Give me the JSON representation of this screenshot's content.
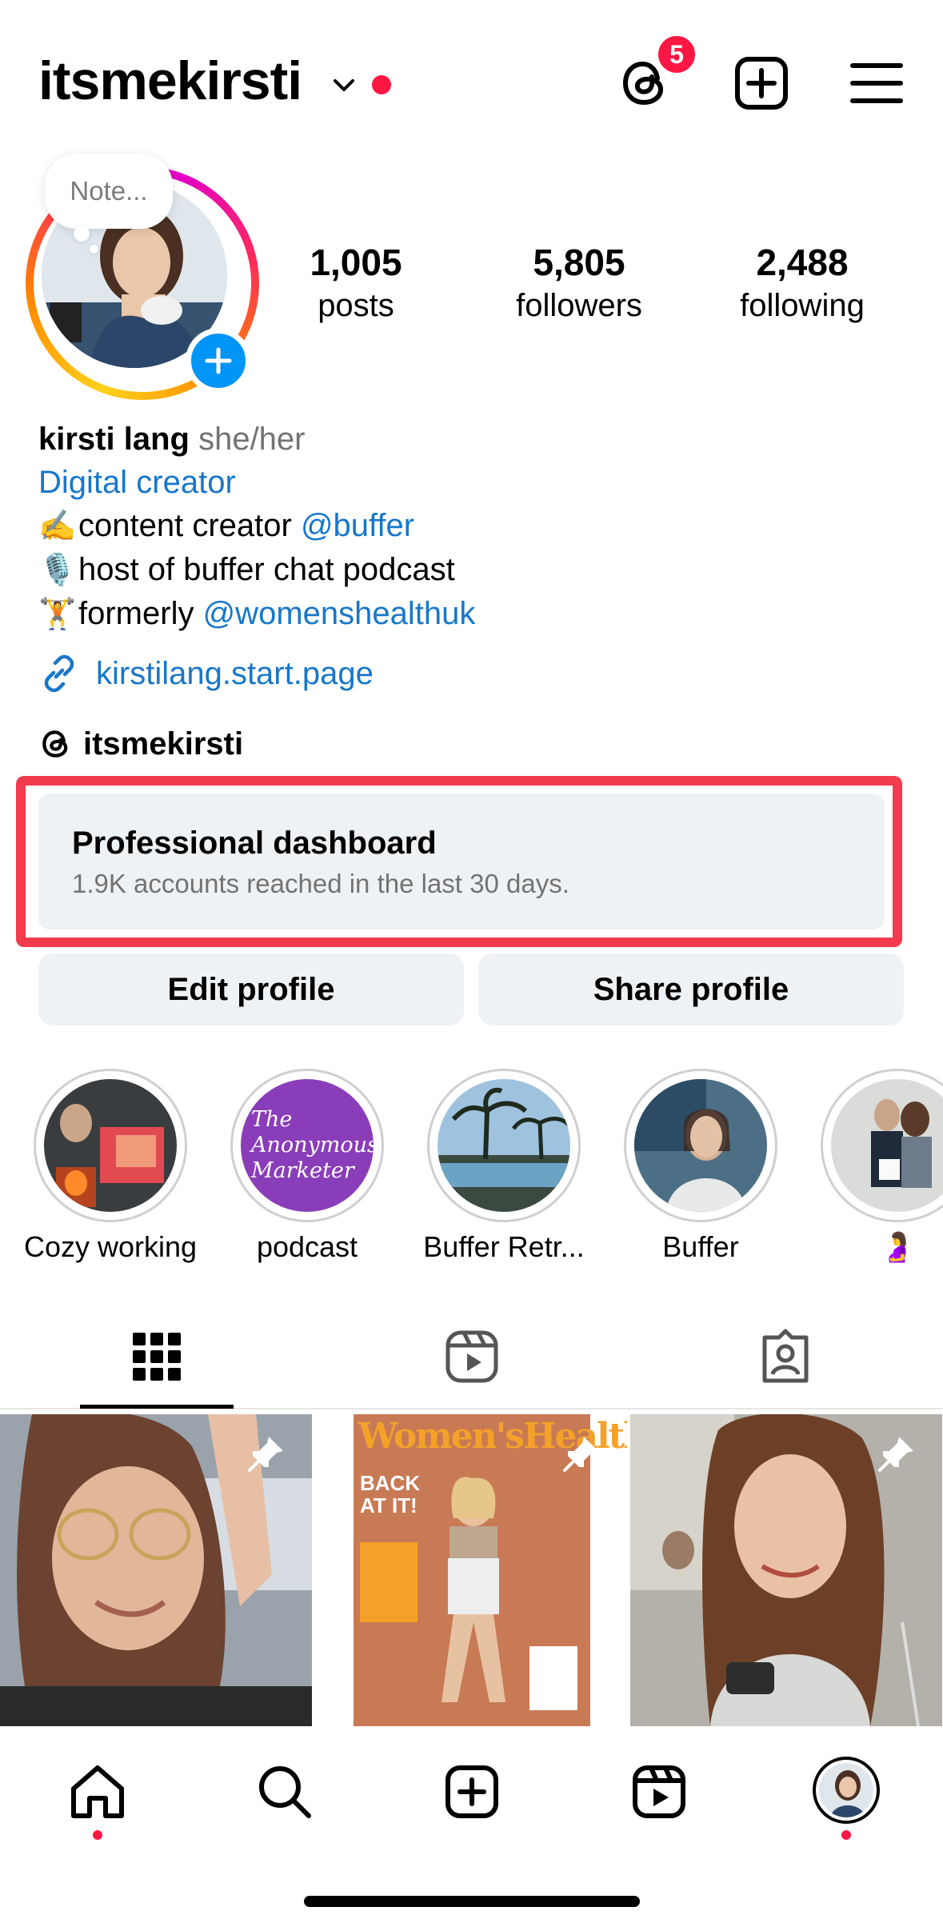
{
  "header": {
    "username": "itsmekirsti",
    "threads_badge_count": "5"
  },
  "profile": {
    "note_placeholder": "Note...",
    "stats": [
      {
        "value": "1,005",
        "label": "posts"
      },
      {
        "value": "5,805",
        "label": "followers"
      },
      {
        "value": "2,488",
        "label": "following"
      }
    ],
    "name": "kirsti lang",
    "pronouns": "she/her",
    "category": "Digital creator",
    "bio_lines": [
      {
        "emoji": "✍️",
        "text": "content creator ",
        "mention": "@buffer"
      },
      {
        "emoji": "🎙️",
        "text": "host of buffer chat podcast",
        "mention": ""
      },
      {
        "emoji": "🏋️",
        "text": "formerly ",
        "mention": "@womenshealthuk"
      }
    ],
    "link": "kirstilang.start.page",
    "threads_handle": "itsmekirsti"
  },
  "dashboard": {
    "title": "Professional dashboard",
    "subtitle": "1.9K accounts reached in the last 30 days."
  },
  "actions": {
    "edit_label": "Edit profile",
    "share_label": "Share profile"
  },
  "highlights": [
    {
      "label": "Cozy working"
    },
    {
      "label": "podcast",
      "cover_text": "The Anonymous Marketer"
    },
    {
      "label": "Buffer Retr..."
    },
    {
      "label": "Buffer"
    },
    {
      "label": "🤰"
    }
  ],
  "tabs": [
    {
      "name": "grid-icon",
      "active": true
    },
    {
      "name": "reels-icon",
      "active": false
    },
    {
      "name": "tagged-icon",
      "active": false
    }
  ],
  "posts": [
    {
      "pinned": true
    },
    {
      "pinned": true,
      "cover_text": "Women'sHealth",
      "cover_sub": "BACK AT IT!"
    },
    {
      "pinned": true
    }
  ],
  "nav": [
    "home-icon",
    "search-icon",
    "create-icon",
    "reels-icon",
    "profile-avatar"
  ],
  "colors": {
    "accent_blue": "#0095f6",
    "link_blue": "#1877c9",
    "notification_red": "#ff1744",
    "highlight_box": "#f23b4d",
    "button_bg": "#eff2f5"
  }
}
